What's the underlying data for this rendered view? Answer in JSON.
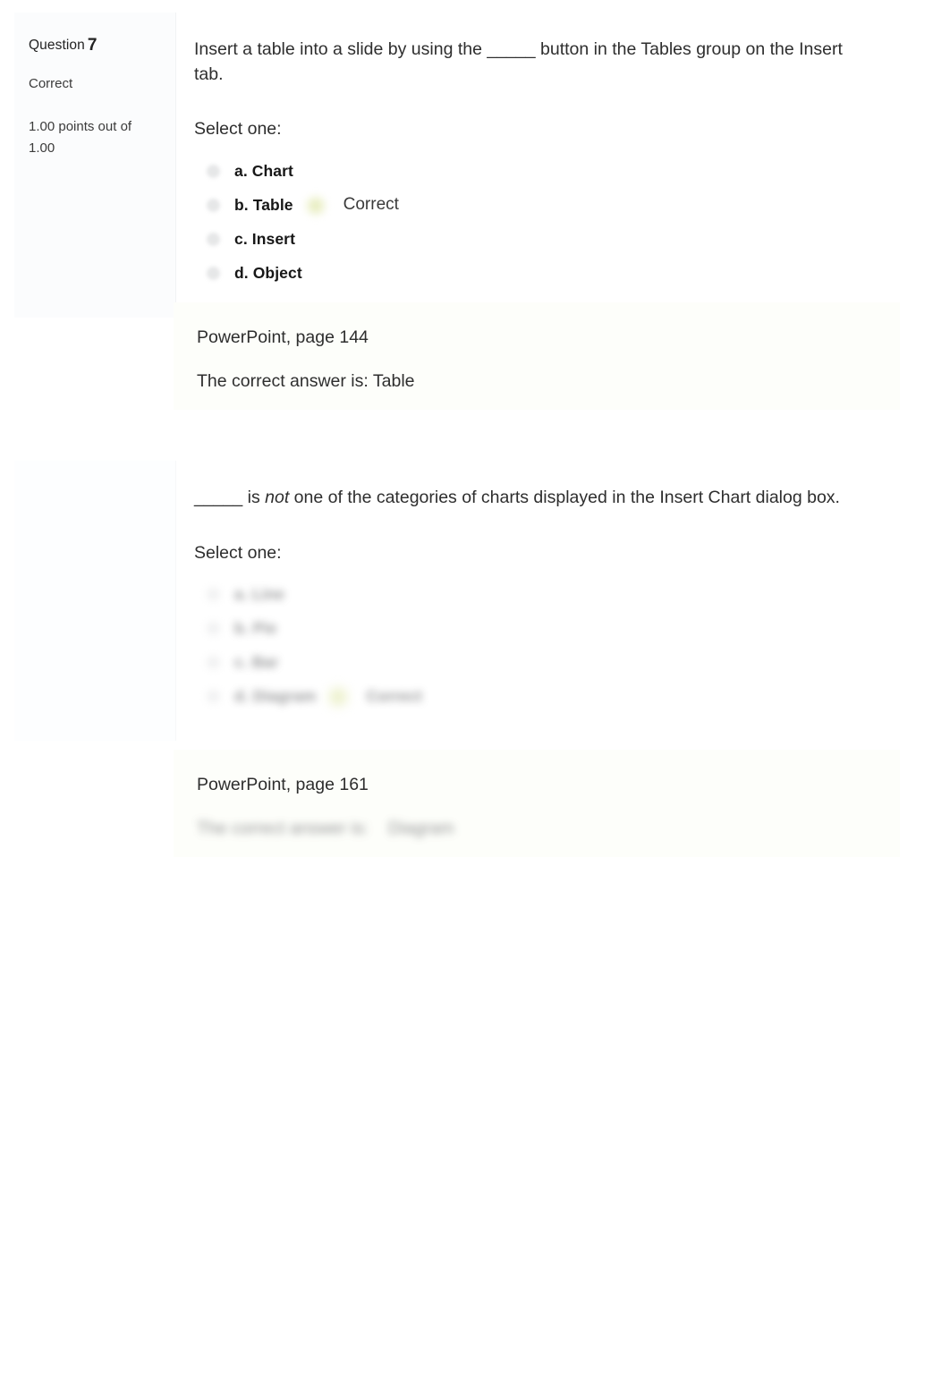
{
  "quiz": {
    "questions": [
      {
        "info": {
          "label": "Question",
          "number": "7",
          "state": "Correct",
          "grade": "1.00 points out of 1.00"
        },
        "text_before_em": "_____ ",
        "stem": "Insert a table into a slide by using the _____ button in the Tables group on the Insert tab.",
        "prompt": "Select one:",
        "answers": [
          {
            "label": "a. Chart",
            "correct_flag": ""
          },
          {
            "label": "b. Table",
            "correct_flag": "Correct"
          },
          {
            "label": "c. Insert",
            "correct_flag": ""
          },
          {
            "label": "d. Object",
            "correct_flag": ""
          }
        ],
        "feedback": {
          "reference": "PowerPoint, page 144",
          "correct_answer": "The correct answer is: Table"
        }
      },
      {
        "info": {
          "label": "",
          "number": "",
          "state": "",
          "grade": ""
        },
        "stem_part1": "_____ is ",
        "stem_em": "not",
        "stem_part2": " one of the categories of charts displayed in the Insert Chart dialog box.",
        "prompt": "Select one:",
        "answers": [
          {
            "label": "a. Line",
            "correct_flag": ""
          },
          {
            "label": "b. Pie",
            "correct_flag": ""
          },
          {
            "label": "c. Bar",
            "correct_flag": ""
          },
          {
            "label": "d. Diagram",
            "correct_flag": "Correct"
          }
        ],
        "feedback": {
          "reference": "PowerPoint, page 161",
          "correct_answer_prefix": "The correct answer is:",
          "correct_answer_value": "Diagram"
        }
      }
    ]
  }
}
